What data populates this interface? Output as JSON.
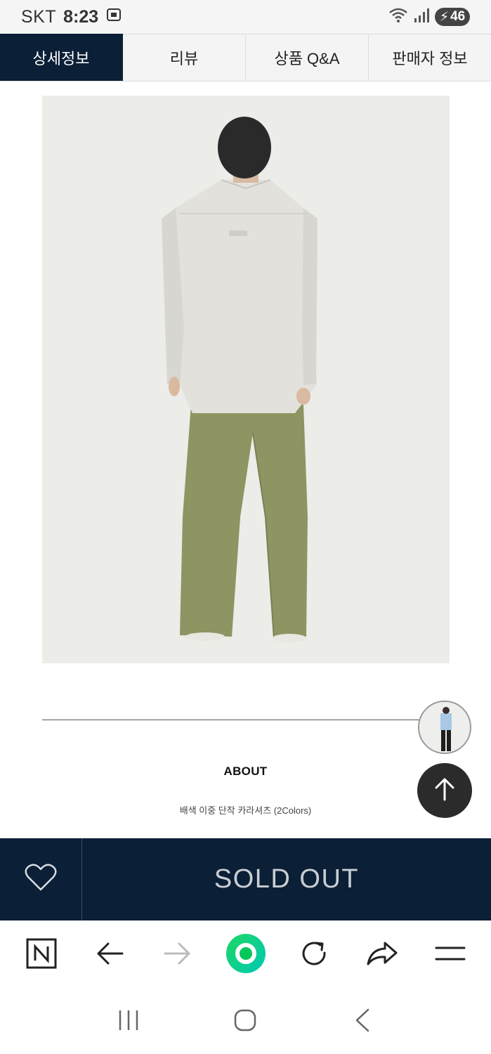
{
  "status": {
    "carrier": "SKT",
    "time": "8:23",
    "battery": "46"
  },
  "tabs": [
    {
      "label": "상세정보",
      "active": true
    },
    {
      "label": "리뷰",
      "active": false
    },
    {
      "label": "상품 Q&A",
      "active": false
    },
    {
      "label": "판매자 정보",
      "active": false
    }
  ],
  "about": {
    "title": "ABOUT",
    "description": "배색 이중 단작 카라셔츠 (2Colors)"
  },
  "purchase": {
    "soldout_label": "SOLD OUT"
  },
  "colors": {
    "navy": "#0b1f36",
    "shirt": "#e3e1dc",
    "pants": "#8e9462",
    "naver_green": "#03c75a"
  },
  "icons": [
    "heart-icon",
    "arrow-up-icon",
    "naver-n-icon",
    "back-arrow-icon",
    "forward-arrow-icon",
    "green-dot-icon",
    "refresh-icon",
    "share-icon",
    "menu-icon",
    "recent-apps-icon",
    "home-icon",
    "nav-back-icon"
  ]
}
